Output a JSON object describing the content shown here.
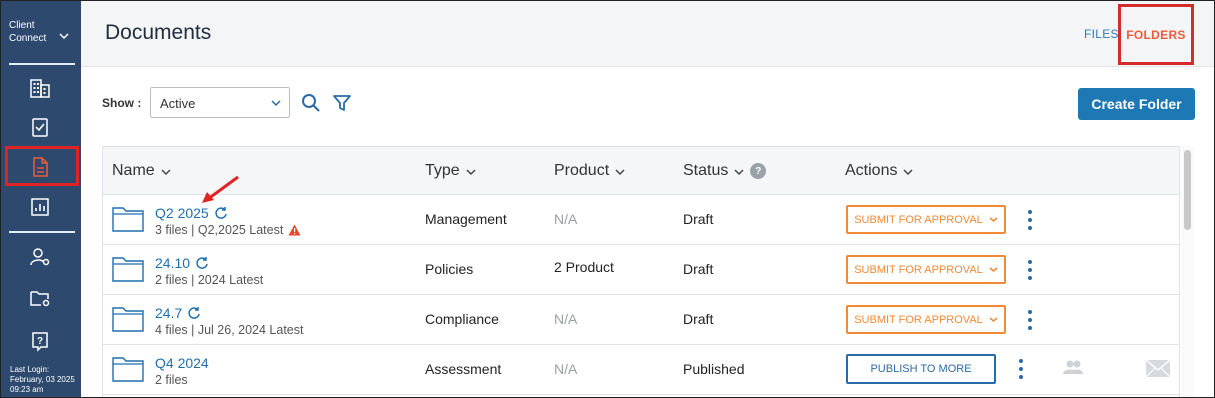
{
  "sidebar": {
    "brand": "Client Connect",
    "items": [
      {
        "icon": "building-icon"
      },
      {
        "icon": "clipboard-check-icon"
      },
      {
        "icon": "document-icon",
        "active": true
      },
      {
        "icon": "report-chart-icon"
      },
      {
        "icon": "user-settings-icon"
      },
      {
        "icon": "folder-settings-icon"
      },
      {
        "icon": "help-document-icon"
      }
    ],
    "last_login_label": "Last Login:",
    "last_login_date": "February, 03 2025",
    "last_login_time": "09:23 am"
  },
  "header": {
    "title": "Documents",
    "tab_files": "FILES",
    "tab_folders": "FOLDERS"
  },
  "toolbar": {
    "show_label": "Show :",
    "show_value": "Active",
    "create_label": "Create Folder"
  },
  "table": {
    "columns": {
      "name": "Name",
      "type": "Type",
      "product": "Product",
      "status": "Status",
      "status_help": "?",
      "actions": "Actions"
    },
    "rows": [
      {
        "name": "Q2 2025",
        "meta": "3 files | Q2,2025 Latest",
        "type": "Management",
        "product": "N/A",
        "status": "Draft",
        "action": "SUBMIT FOR APPROVAL"
      },
      {
        "name": "24.10",
        "meta": "2 files | 2024 Latest",
        "type": "Policies",
        "product": "2 Product",
        "status": "Draft",
        "action": "SUBMIT FOR APPROVAL"
      },
      {
        "name": "24.7",
        "meta": "4 files | Jul 26, 2024 Latest",
        "type": "Compliance",
        "product": "N/A",
        "status": "Draft",
        "action": "SUBMIT FOR APPROVAL"
      },
      {
        "name": "Q4 2024",
        "meta": "2 files",
        "type": "Assessment",
        "product": "N/A",
        "status": "Published",
        "action": "PUBLISH TO MORE"
      }
    ]
  },
  "colors": {
    "sidebar_bg": "#2d4a6e",
    "accent_blue": "#1e78b4",
    "submit_orange": "#f08a38",
    "highlight_red": "#d62b2b",
    "warning_red": "#e8472b"
  }
}
